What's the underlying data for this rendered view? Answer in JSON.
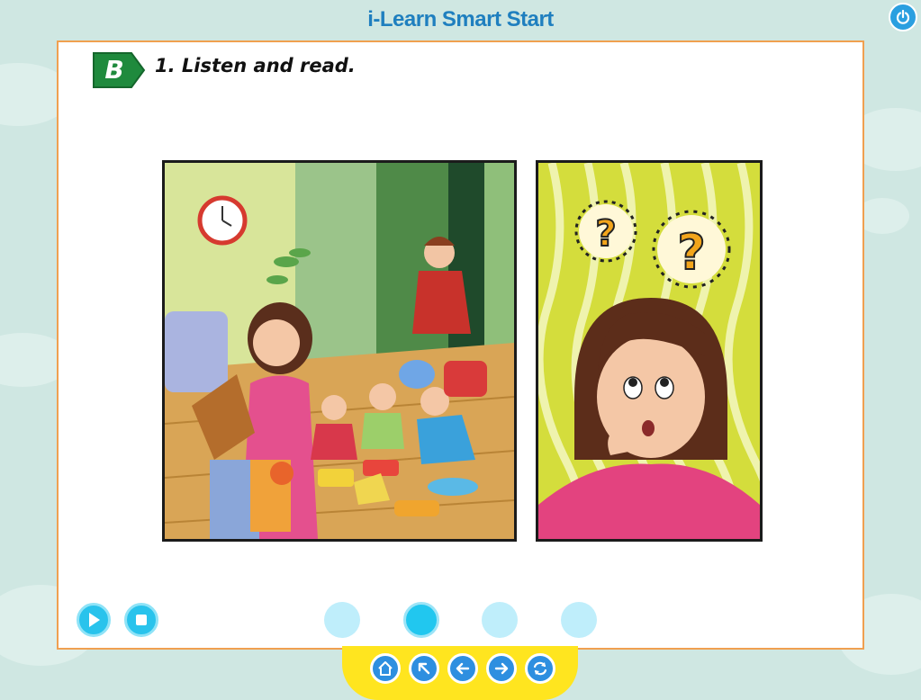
{
  "app": {
    "title": "i-Learn Smart Start"
  },
  "section": {
    "badge": "B",
    "instruction": "1. Listen and read."
  },
  "illustrations": [
    {
      "name": "family-messy-room-scene"
    },
    {
      "name": "girl-thinking-scene"
    }
  ],
  "audio_controls": {
    "play_icon": "play-icon",
    "stop_icon": "stop-icon"
  },
  "page_dots": {
    "count": 4,
    "active_index": 1
  },
  "nav": {
    "buttons": [
      "home-icon",
      "back-arrow-icon",
      "previous-icon",
      "next-icon",
      "refresh-icon"
    ]
  },
  "colors": {
    "accent": "#29c3ec",
    "title": "#1f7fbf",
    "badge": "#1f8a3d",
    "nav_bar": "#ffe51f",
    "panel_border": "#f0a050"
  }
}
